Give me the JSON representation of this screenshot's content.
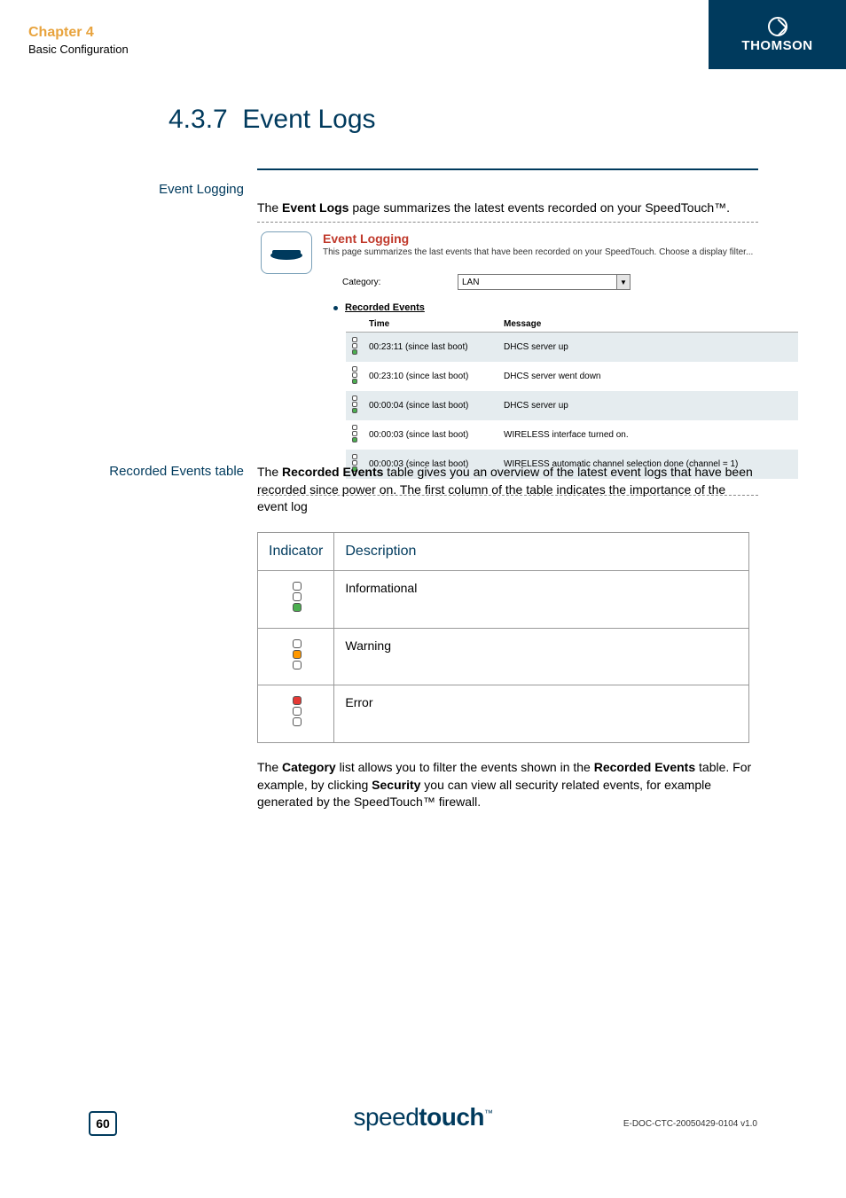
{
  "header": {
    "brand": "THOMSON",
    "chapter_title": "Chapter 4",
    "chapter_sub": "Basic Configuration"
  },
  "section": {
    "number": "4.3.7",
    "title": "Event Logs"
  },
  "side_labels": {
    "event_logging": "Event Logging",
    "recorded_events": "Recorded Events table"
  },
  "intro_para": {
    "pre": "The ",
    "bold": "Event Logs",
    "post": " page summarizes the latest events recorded on your SpeedTouch™."
  },
  "screenshot": {
    "title": "Event Logging",
    "desc": "This page summarizes the last events that have been recorded on your SpeedTouch. Choose a display filter...",
    "category_label": "Category:",
    "category_value": "LAN",
    "recorded_heading": "Recorded Events",
    "columns": {
      "time": "Time",
      "message": "Message"
    },
    "rows": [
      {
        "level": "info",
        "time": "00:23:11 (since last boot)",
        "msg": "DHCS server up"
      },
      {
        "level": "info",
        "time": "00:23:10 (since last boot)",
        "msg": "DHCS server went down"
      },
      {
        "level": "info",
        "time": "00:00:04 (since last boot)",
        "msg": "DHCS server up"
      },
      {
        "level": "info",
        "time": "00:00:03 (since last boot)",
        "msg": "WIRELESS interface turned on."
      },
      {
        "level": "info",
        "time": "00:00:03 (since last boot)",
        "msg": "WIRELESS automatic channel selection done (channel = 1)"
      }
    ]
  },
  "recorded_para": {
    "pre": "The ",
    "bold": "Recorded Events",
    "post": " table gives you an overview of the latest event logs that have been recorded since power on. The first column of the table indicates the importance of the event log"
  },
  "indicator_table": {
    "head_indicator": "Indicator",
    "head_description": "Description",
    "rows": [
      {
        "level": "info",
        "desc": "Informational"
      },
      {
        "level": "warn",
        "desc": "Warning"
      },
      {
        "level": "error",
        "desc": "Error"
      }
    ]
  },
  "category_para": {
    "p1a": "The ",
    "p1b": "Category",
    "p1c": " list allows you to filter the events shown in the ",
    "p1d": "Recorded Events",
    "p1e": " table. For example, by clicking ",
    "p1f": "Security",
    "p1g": " you can view all security related events, for example generated by the SpeedTouch™ firewall."
  },
  "footer": {
    "logo_thin": "speed",
    "logo_bold": "touch",
    "tm": "™",
    "page": "60",
    "docref": "E-DOC-CTC-20050429-0104 v1.0"
  }
}
